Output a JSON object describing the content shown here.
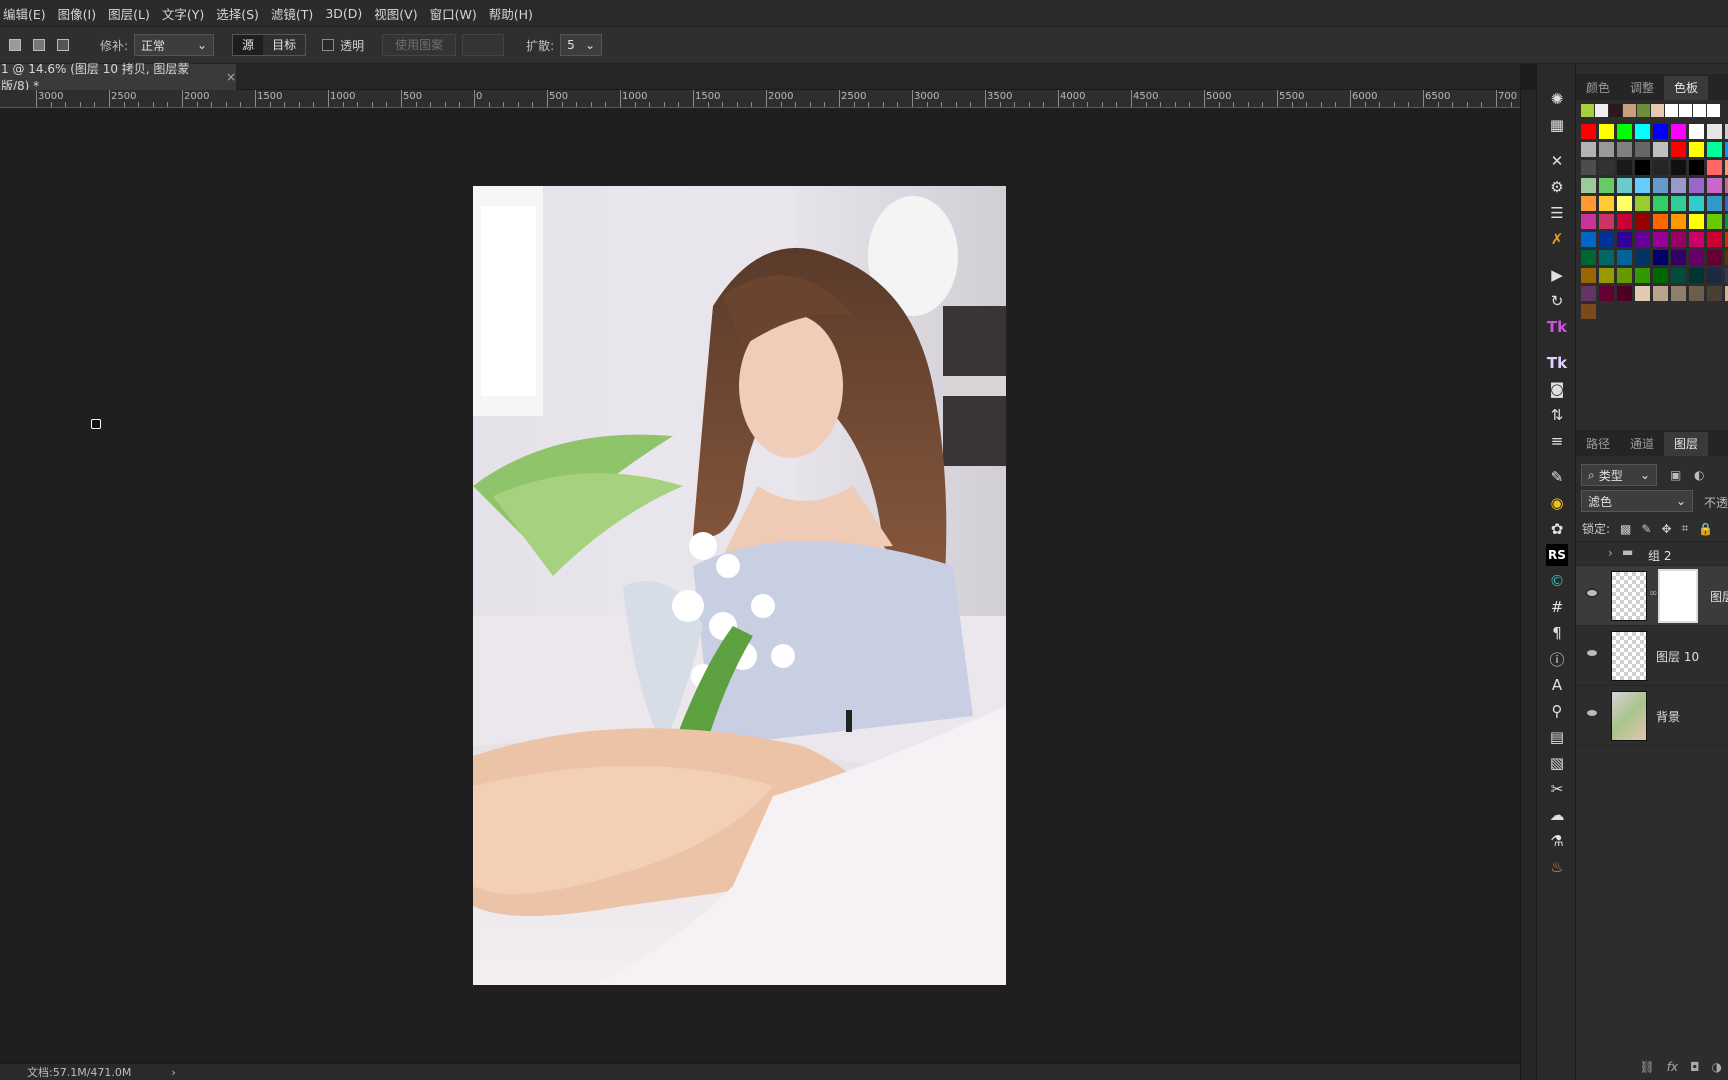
{
  "menu": [
    "编辑(E)",
    "图像(I)",
    "图层(L)",
    "文字(Y)",
    "选择(S)",
    "滤镜(T)",
    "3D(D)",
    "视图(V)",
    "窗口(W)",
    "帮助(H)"
  ],
  "options": {
    "repair_label": "修补:",
    "repair_value": "正常",
    "source": "源",
    "target": "目标",
    "transparent": "透明",
    "use_pattern": "使用图案",
    "spread_label": "扩散:",
    "spread_value": "5"
  },
  "doc_tab": {
    "title": "1 @ 14.6% (图层 10 拷贝, 图层蒙版/8) *",
    "close": "×"
  },
  "ruler_labels": [
    "3000",
    "2500",
    "2000",
    "1500",
    "1000",
    "500",
    "0",
    "500",
    "1000",
    "1500",
    "2000",
    "2500",
    "3000",
    "3500",
    "4000",
    "4500",
    "5000",
    "5500",
    "6000",
    "6500",
    "700"
  ],
  "status": {
    "doc": "文档:57.1M/471.0M",
    "arrow": "›"
  },
  "panels": {
    "top_tabs": [
      "颜色",
      "调整",
      "色板"
    ],
    "layer_tabs": [
      "路径",
      "通道",
      "图层"
    ],
    "filter_kind": "类型",
    "blend_mode": "滤色",
    "opacity_label": "不透",
    "lock_label": "锁定:",
    "layers": [
      {
        "name": "组 2"
      },
      {
        "name": "图层"
      },
      {
        "name": "图层 10"
      },
      {
        "name": "背景"
      }
    ]
  },
  "colors": {
    "swatch_row1": [
      "#a6d13d",
      "#f0f0f0",
      "#2a1a1a",
      "#c8a080",
      "#6e8f3a",
      "#e8c8b0",
      "#ffffff",
      "#ffffff",
      "#ffffff",
      "#ffffff"
    ],
    "swatch_grid": [
      [
        "#ff0000",
        "#ffff00",
        "#00ff00",
        "#00ffff",
        "#0000ff",
        "#ff00ff",
        "#ffffff",
        "#e6e6e6",
        "#cccccc"
      ],
      [
        "#b3b3b3",
        "#999999",
        "#808080",
        "#666666",
        "#c0c0c0",
        "#ff0000",
        "#ffff00",
        "#00ff99",
        "#0099ff"
      ],
      [
        "#4d4d4d",
        "#333333",
        "#1a1a1a",
        "#000000",
        "#262626",
        "#101010",
        "#000000",
        "#ff6666",
        "#ff9966"
      ],
      [
        "#99cc99",
        "#66cc66",
        "#66cccc",
        "#66ccff",
        "#6699cc",
        "#9999cc",
        "#9966cc",
        "#cc66cc",
        "#cc6699"
      ],
      [
        "#ff9933",
        "#ffcc33",
        "#ffff66",
        "#99cc33",
        "#33cc66",
        "#33cc99",
        "#33cccc",
        "#3399cc",
        "#3366cc"
      ],
      [
        "#cc3399",
        "#cc3366",
        "#cc0033",
        "#990000",
        "#ff6600",
        "#ff9900",
        "#ffff00",
        "#66cc00",
        "#009933"
      ],
      [
        "#0066cc",
        "#003399",
        "#330099",
        "#660099",
        "#990099",
        "#990066",
        "#cc0066",
        "#cc0033",
        "#cc3300"
      ],
      [
        "#006633",
        "#006666",
        "#006699",
        "#003366",
        "#000066",
        "#330066",
        "#660066",
        "#660033",
        "#663300"
      ],
      [
        "#996600",
        "#999900",
        "#669900",
        "#339900",
        "#006600",
        "#004d40",
        "#003333",
        "#1a2a40",
        "#333366"
      ],
      [
        "#663366",
        "#660033",
        "#4d0026",
        "#e0cbb0",
        "#b8a58e",
        "#8f7f6a",
        "#6b5e4e",
        "#4a3f33",
        "#d4b48c"
      ],
      [
        "#7a4a1a"
      ]
    ]
  }
}
